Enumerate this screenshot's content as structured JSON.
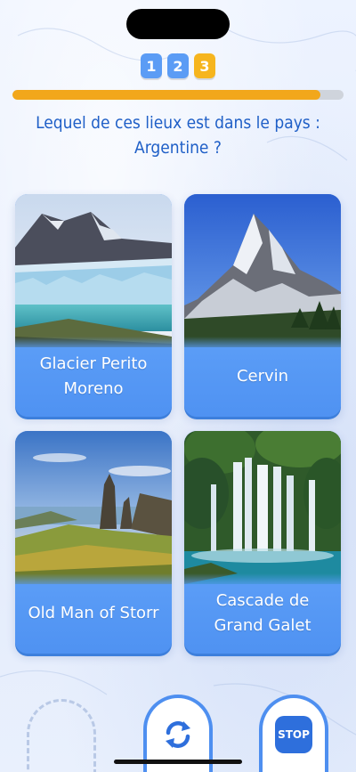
{
  "steps": [
    {
      "label": "1",
      "active": false
    },
    {
      "label": "2",
      "active": false
    },
    {
      "label": "3",
      "active": true
    }
  ],
  "progress": 0.93,
  "question": "Lequel de ces lieux est dans le pays : Argentine ?",
  "answers": [
    {
      "label": "Glacier Perito Moreno",
      "image": "glacier-photo"
    },
    {
      "label": "Cervin",
      "image": "mountain-photo"
    },
    {
      "label": "Old Man of Storr",
      "image": "rock-pinnacle-photo"
    },
    {
      "label": "Cascade de Grand Galet",
      "image": "waterfall-photo"
    }
  ],
  "controls": {
    "stop_label": "STOP",
    "refresh_icon": "refresh-icon"
  },
  "colors": {
    "accent": "#1f5fc7",
    "card": "#5a9cf6",
    "progress": "#f2a71b",
    "active_step": "#f6b51e"
  }
}
